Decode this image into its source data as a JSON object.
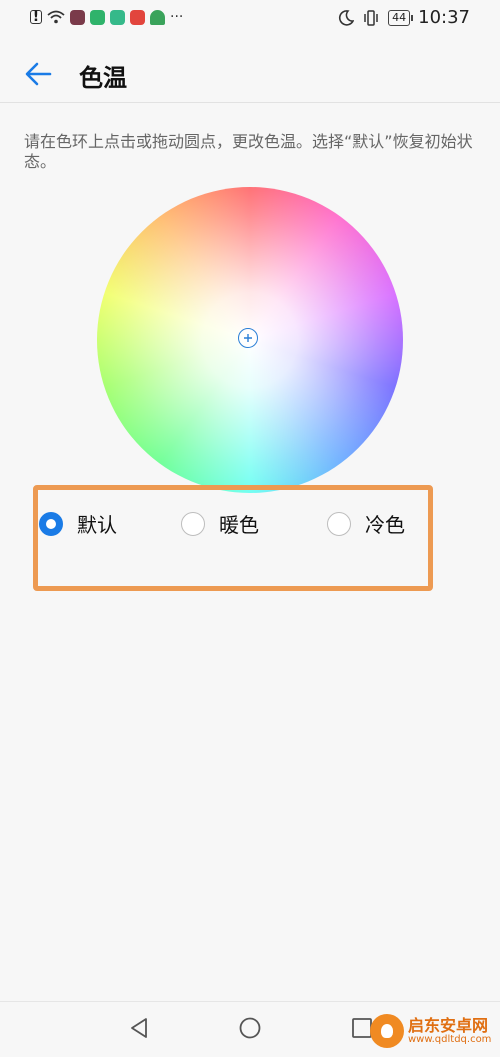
{
  "status_bar": {
    "time": "10:37",
    "battery": "44",
    "overflow": "···"
  },
  "header": {
    "title": "色温"
  },
  "description": "请在色环上点击或拖动圆点，更改色温。选择“默认”恢复初始状态。",
  "options": [
    {
      "label": "默认",
      "selected": true
    },
    {
      "label": "暖色",
      "selected": false
    },
    {
      "label": "冷色",
      "selected": false
    }
  ],
  "watermark": {
    "title": "启东安卓网",
    "url": "www.qdltdq.com"
  },
  "colors": {
    "accent": "#1a7be6",
    "highlight_box": "#ed9a52"
  }
}
